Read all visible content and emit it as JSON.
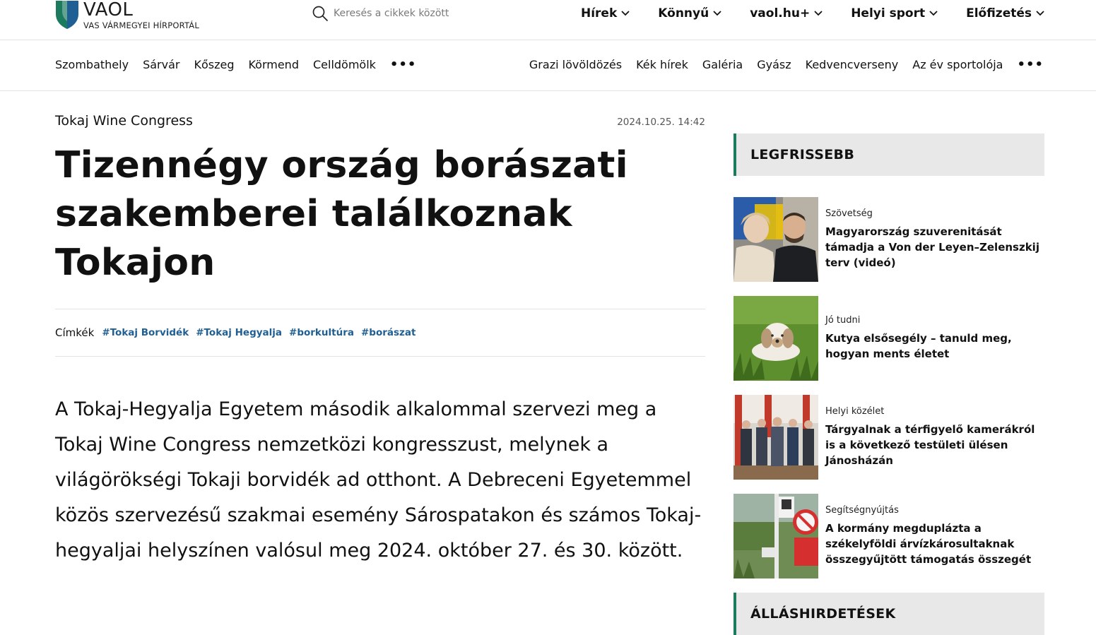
{
  "brand": {
    "name": "VAOL",
    "tagline": "VAS VÁRMEGYEI HÍRPORTÁL",
    "shield_green": "#1c7a5f",
    "shield_blue": "#1f5f94"
  },
  "search": {
    "placeholder": "Keresés a cikkek között"
  },
  "main_nav": [
    {
      "label": "Hírek"
    },
    {
      "label": "Könnyű"
    },
    {
      "label": "vaol.hu+"
    },
    {
      "label": "Helyi sport"
    },
    {
      "label": "Előfizetés"
    }
  ],
  "city_nav": [
    "Szombathely",
    "Sárvár",
    "Kőszeg",
    "Körmend",
    "Celldömölk"
  ],
  "topic_nav": [
    "Grazi lövöldözés",
    "Kék hírek",
    "Galéria",
    "Gyász",
    "Kedvencverseny",
    "Az év sportolója"
  ],
  "more_label": "•••",
  "article": {
    "kicker": "Tokaj Wine Congress",
    "date": "2024.10.25. 14:42",
    "title": "Tizennégy ország borászati szakemberei találkoznak Tokajon",
    "tags_label": "Címkék",
    "tags": [
      "#Tokaj Borvidék",
      "#Tokaj Hegyalja",
      "#borkultúra",
      "#borászat"
    ],
    "lead": "A Tokaj-Hegyalja Egyetem második alkalommal szervezi meg a Tokaj Wine Congress nemzetközi kongresszust, melynek a világörökségi Tokaji borvidék ad otthont. A Debreceni Egyetemmel közös szervezésű szakmai esemény Sárospatakon és számos Tokaj-hegyaljai helyszínen valósul meg 2024. október 27. és 30. között."
  },
  "sidebar": {
    "latest_heading": "LEGFRISSEBB",
    "news": [
      {
        "category": "Szövetség",
        "title": "Magyarország szuverenitását támadja a Von der Leyen–Zelenszkij terv (videó)",
        "image": "photo-politicians"
      },
      {
        "category": "Jó tudni",
        "title": "Kutya elsősegély – tanuld meg, hogyan ments életet",
        "image": "photo-puppy"
      },
      {
        "category": "Helyi közélet",
        "title": "Tárgyalnak a térfigyelő kamerákról is a következő testületi ülésen Jánosházán",
        "image": "photo-group"
      },
      {
        "category": "Segítségnyújtás",
        "title": "A kormány megduplázta a székelyföldi árvízkárosultaknak összegyűjtött támogatás összegét",
        "image": "photo-flood-sign"
      }
    ],
    "jobs_heading": "ÁLLÁSHIRDETÉSEK"
  }
}
